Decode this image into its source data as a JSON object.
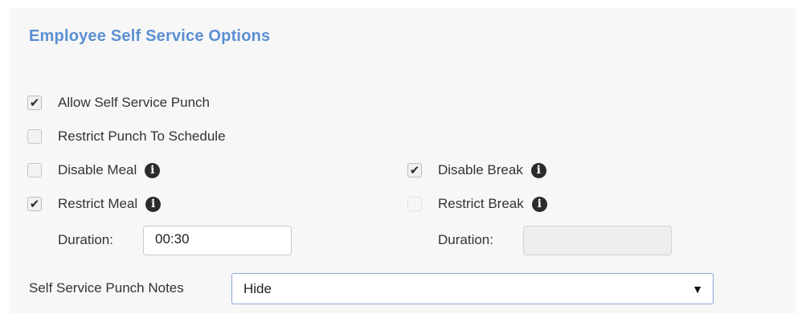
{
  "section": {
    "title": "Employee Self Service Options"
  },
  "options": {
    "allow_self_service_punch": {
      "label": "Allow Self Service Punch",
      "checked": true
    },
    "restrict_punch_to_schedule": {
      "label": "Restrict Punch To Schedule",
      "checked": false
    },
    "disable_meal": {
      "label": "Disable Meal",
      "checked": false
    },
    "disable_break": {
      "label": "Disable Break",
      "checked": true
    },
    "restrict_meal": {
      "label": "Restrict Meal",
      "checked": true
    },
    "restrict_break": {
      "label": "Restrict Break",
      "checked": false,
      "disabled": true
    }
  },
  "meal_duration": {
    "label": "Duration:",
    "value": "00:30"
  },
  "break_duration": {
    "label": "Duration:",
    "value": ""
  },
  "punch_notes": {
    "label": "Self Service Punch Notes",
    "selected": "Hide"
  },
  "icons": {
    "check": "✔",
    "info": "i",
    "dropdown": "▼"
  }
}
